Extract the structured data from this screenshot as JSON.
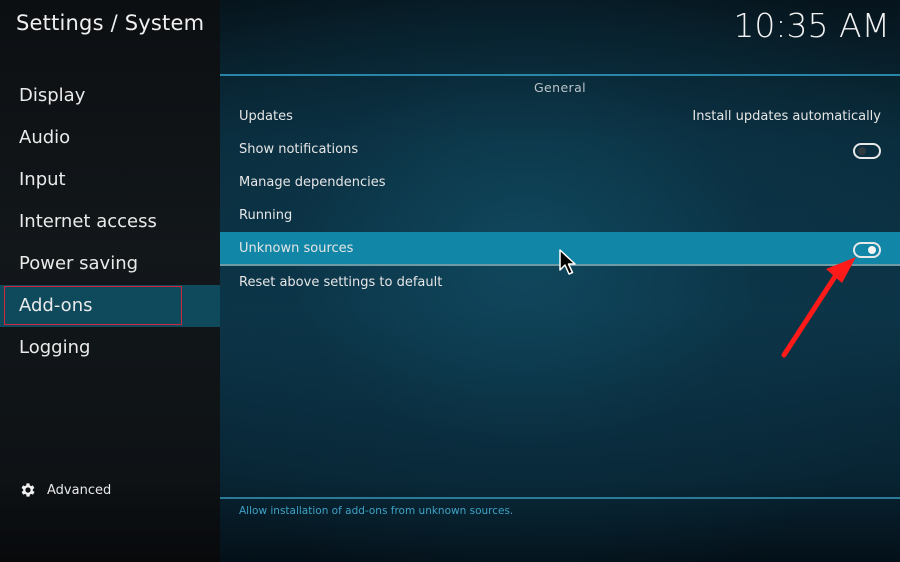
{
  "header": {
    "title": "Settings / System",
    "clock": "10:35 AM"
  },
  "sidebar": {
    "items": [
      {
        "label": "Display",
        "active": false
      },
      {
        "label": "Audio",
        "active": false
      },
      {
        "label": "Input",
        "active": false
      },
      {
        "label": "Internet access",
        "active": false
      },
      {
        "label": "Power saving",
        "active": false
      },
      {
        "label": "Add-ons",
        "active": true
      },
      {
        "label": "Logging",
        "active": false
      }
    ],
    "advanced": {
      "label": "Advanced",
      "icon": "gear-icon"
    }
  },
  "main": {
    "group_label": "General",
    "settings": [
      {
        "label": "Updates",
        "value": "Install updates automatically"
      },
      {
        "label": "Show notifications",
        "toggle": false
      },
      {
        "label": "Manage dependencies"
      },
      {
        "label": "Running"
      },
      {
        "label": "Unknown sources",
        "toggle": true,
        "selected": true
      },
      {
        "label": "Reset above settings to default"
      }
    ],
    "description": "Allow installation of add-ons from unknown sources."
  },
  "colors": {
    "accent": "#1186a6",
    "highlight_box": "#d0283a",
    "annotation_arrow": "#ff1a1a",
    "description_text": "#3ea2c6"
  }
}
